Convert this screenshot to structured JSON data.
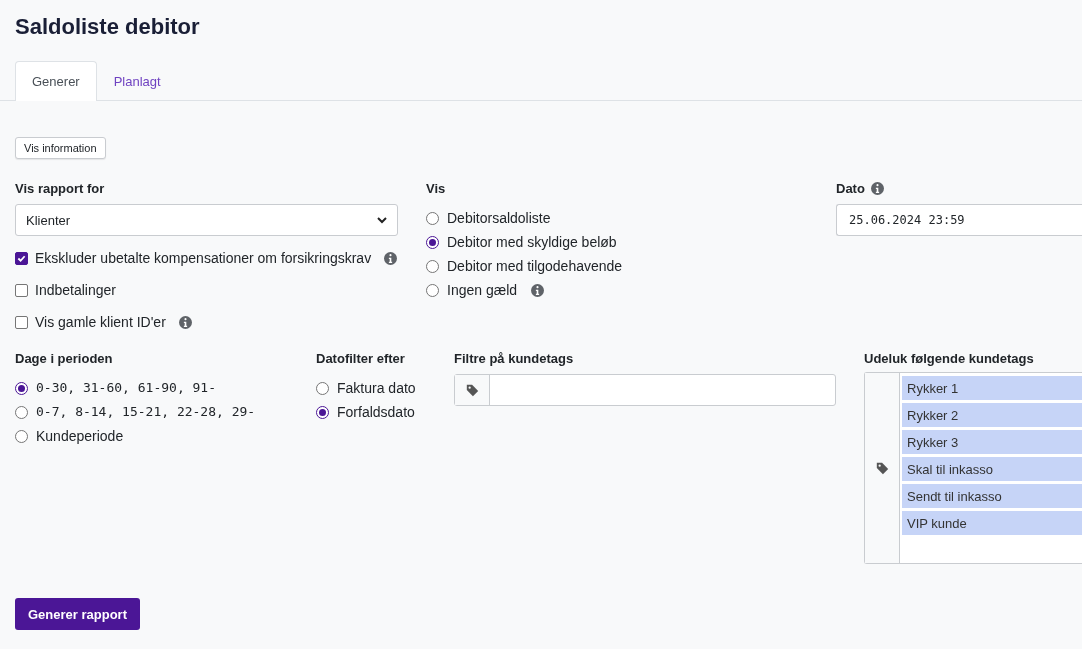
{
  "title": "Saldoliste debitor",
  "tabs": [
    {
      "label": "Generer",
      "selected": true
    },
    {
      "label": "Planlagt",
      "selected": false
    }
  ],
  "info_button": "Vis information",
  "report_for": {
    "label": "Vis rapport for",
    "value": "Klienter"
  },
  "options": [
    {
      "label": "Ekskluder ubetalte kompensationer om forsikringskrav",
      "checked": true,
      "info": true
    },
    {
      "label": "Indbetalinger",
      "checked": false,
      "info": false
    },
    {
      "label": "Vis gamle klient ID'er",
      "checked": false,
      "info": true
    }
  ],
  "vis": {
    "label": "Vis",
    "options": [
      {
        "label": "Debitorsaldoliste",
        "selected": false,
        "info": false
      },
      {
        "label": "Debitor med skyldige beløb",
        "selected": true,
        "info": false
      },
      {
        "label": "Debitor med tilgodehavende",
        "selected": false,
        "info": false
      },
      {
        "label": "Ingen gæld",
        "selected": false,
        "info": true
      }
    ]
  },
  "dato": {
    "label": "Dato",
    "value": "25.06.2024 23:59",
    "info": true
  },
  "days": {
    "label": "Dage i perioden",
    "options": [
      {
        "label": "0-30, 31-60, 61-90, 91-",
        "selected": true,
        "kind": "range"
      },
      {
        "label": "0-7, 8-14, 15-21, 22-28, 29-",
        "selected": false,
        "kind": "range"
      },
      {
        "label": "Kundeperiode",
        "selected": false,
        "kind": "custom"
      }
    ]
  },
  "date_filter": {
    "label": "Datofilter efter",
    "options": [
      {
        "label": "Faktura dato",
        "selected": false
      },
      {
        "label": "Forfaldsdato",
        "selected": true
      }
    ]
  },
  "tag_filter": {
    "label": "Filtre på kundetags"
  },
  "exclude_tags": {
    "label": "Udeluk følgende kundetags",
    "tags": [
      {
        "label": "Rykker 1",
        "selected": true
      },
      {
        "label": "Rykker 2",
        "selected": true
      },
      {
        "label": "Rykker 3",
        "selected": true
      },
      {
        "label": "Skal til inkasso",
        "selected": true
      },
      {
        "label": "Sendt til inkasso",
        "selected": true
      },
      {
        "label": "VIP kunde",
        "selected": true
      }
    ]
  },
  "submit": "Generer rapport"
}
